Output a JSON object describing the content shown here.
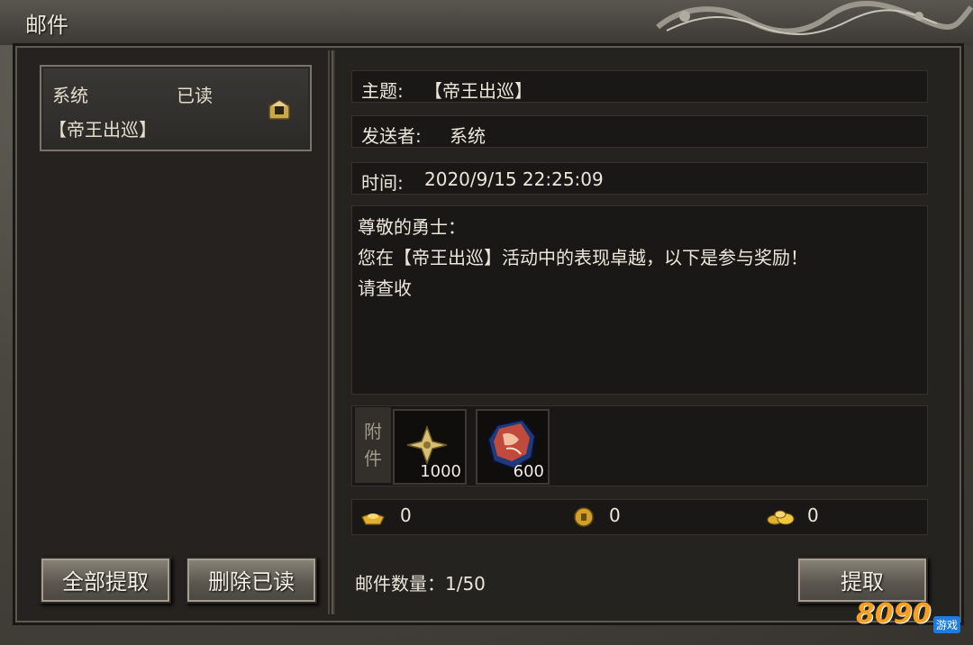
{
  "window": {
    "title": "邮件"
  },
  "mail_list": [
    {
      "sender": "系统",
      "status": "已读",
      "subject": "【帝王出巡】"
    }
  ],
  "left_buttons": {
    "collect_all": "全部提取",
    "delete_read": "删除已读"
  },
  "detail": {
    "subject_label": "主题:",
    "subject_value": "【帝王出巡】",
    "sender_label": "发送者:",
    "sender_value": "系统",
    "time_label": "时间:",
    "time_value": "2020/9/15 22:25:09",
    "body_lines": [
      "尊敬的勇士：",
      "您在【帝王出巡】活动中的表现卓越，以下是参与奖励！",
      "请查收"
    ]
  },
  "attachments": {
    "label_line1": "附",
    "label_line2": "件",
    "items": [
      {
        "icon": "gold-star-shuriken-icon",
        "quantity": "1000"
      },
      {
        "icon": "red-gem-ore-icon",
        "quantity": "600"
      }
    ]
  },
  "currencies": [
    {
      "icon": "gold-ingot-icon",
      "value": "0"
    },
    {
      "icon": "gold-coin-icon",
      "value": "0"
    },
    {
      "icon": "gold-nugget-pile-icon",
      "value": "0"
    }
  ],
  "mail_count": "邮件数量：1/50",
  "collect_button": "提取",
  "watermark": {
    "logo": "8090",
    "sub": "游戏"
  },
  "colors": {
    "accent_gold": "#e0b030",
    "panel_dark": "#1a1816",
    "frame_stone": "#5e5a52"
  }
}
